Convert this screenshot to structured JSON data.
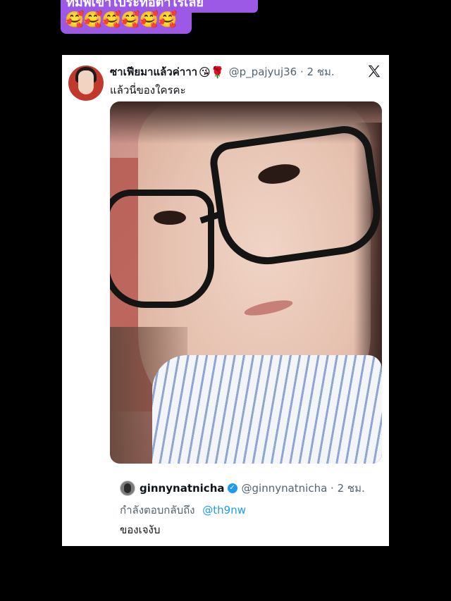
{
  "overlay": {
    "caption_line1": "ทีมพี่เขาไประทือตาไรเลย",
    "caption_emojis": "🥰🥰🥰🥰🥰🥰"
  },
  "tweet": {
    "display_name": "ซาเฟียมาแล้วค่าาา",
    "name_emojis": "😘🌹",
    "handle_time": "@p_pajyuj36 · 2 ชม.",
    "text": "แล้วนี่ของใครคะ"
  },
  "quoted": {
    "display_name": "ginnynatnicha",
    "verified_mark": "✓",
    "handle_time": "@ginnynatnicha · 2 ชม.",
    "reply_prefix": "กำลังตอบกลับถึง",
    "reply_mention": "@th9nw",
    "text": "ของเจงับ"
  },
  "colors": {
    "accent_purple": "#9b59e6",
    "link_blue": "#1d9bf0",
    "muted_gray": "#536471"
  }
}
